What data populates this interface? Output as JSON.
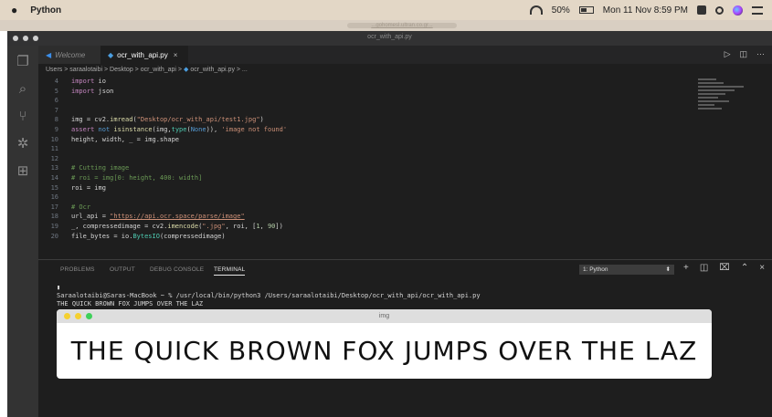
{
  "menubar": {
    "apple_icon": "apple-icon",
    "app_name": "Python",
    "battery_percent": "50%",
    "clock": "Mon 11 Nov  8:59 PM"
  },
  "browser": {
    "url_hint": "...gohomesl.ultran.co.gr..."
  },
  "window": {
    "title": "ocr_with_api.py"
  },
  "activity_icons": [
    "files-icon",
    "search-icon",
    "source-control-icon",
    "debug-icon",
    "extensions-icon"
  ],
  "tabs": [
    {
      "label": "Welcome",
      "icon": "vscode-icon"
    },
    {
      "label": "ocr_with_api.py",
      "icon": "python-icon",
      "close": "×"
    }
  ],
  "breadcrumb": "Users > saraalotaibi > Desktop > ocr_with_api > ",
  "breadcrumb_file": "ocr_with_api.py > ...",
  "editor": {
    "line_numbers": [
      "4",
      "5",
      "6",
      "7",
      "8",
      "9",
      "10",
      "11",
      "12",
      "13",
      "14",
      "15",
      "16",
      "17",
      "18",
      "19",
      "20"
    ]
  },
  "panel": {
    "tabs": [
      "PROBLEMS",
      "OUTPUT",
      "DEBUG CONSOLE",
      "TERMINAL"
    ],
    "active_tab": "TERMINAL",
    "terminal_select": "1: Python",
    "terminal_lines": [
      "Saraalotaibi@Saras-MacBook ~ % /usr/local/bin/python3 /Users/saraalotaibi/Desktop/ocr_with_api/ocr_with_api.py",
      "THE QUICK BROWN FOX JUMPS OVER THE LAZ"
    ]
  },
  "img_window": {
    "title": "img",
    "text": "THE QUICK BROWN FOX JUMPS OVER THE LAZ"
  },
  "colors": {
    "editor_bg": "#1e1e1e",
    "activity_bg": "#333333",
    "string": "#ce9178",
    "comment": "#6a9955",
    "keyword": "#c586c0"
  }
}
